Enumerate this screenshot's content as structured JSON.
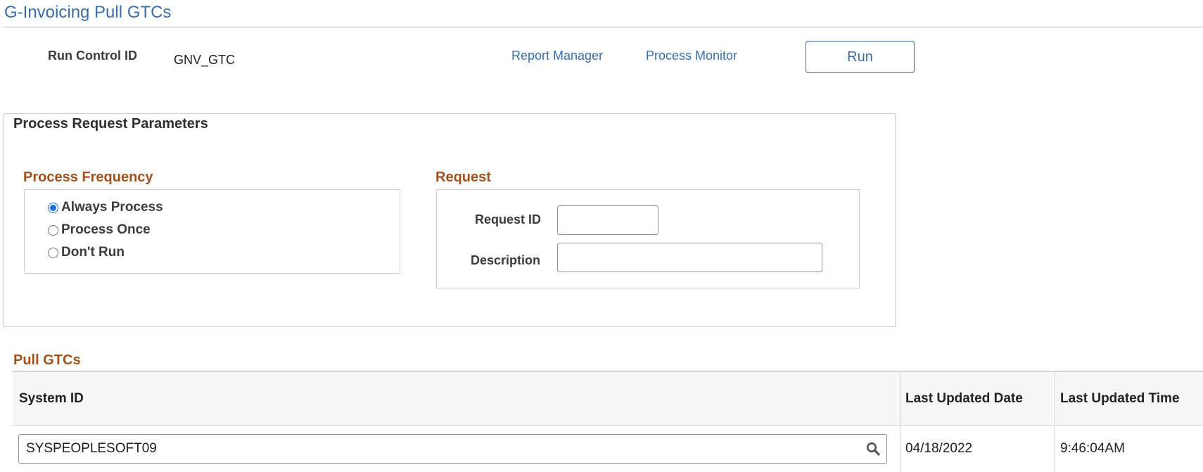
{
  "page": {
    "title": "G-Invoicing Pull GTCs"
  },
  "header": {
    "run_control_label": "Run Control ID",
    "run_control_value": "GNV_GTC",
    "report_manager_link": "Report Manager",
    "process_monitor_link": "Process Monitor",
    "run_button": "Run"
  },
  "params": {
    "title": "Process Request Parameters",
    "frequency": {
      "title": "Process Frequency",
      "options": [
        {
          "label": "Always Process",
          "selected": true
        },
        {
          "label": "Process Once",
          "selected": false
        },
        {
          "label": "Don't Run",
          "selected": false
        }
      ]
    },
    "request": {
      "title": "Request",
      "request_id_label": "Request ID",
      "request_id_value": "",
      "description_label": "Description",
      "description_value": ""
    }
  },
  "grid": {
    "title": "Pull GTCs",
    "columns": [
      "System ID",
      "Last Updated Date",
      "Last Updated Time"
    ],
    "rows": [
      {
        "system_id": "SYSPEOPLESOFT09",
        "date": "04/18/2022",
        "time": "9:46:04AM"
      }
    ]
  },
  "icons": {
    "lookup": "search-icon"
  },
  "colors": {
    "link": "#3a6ea8",
    "section_heading": "#a0521e",
    "radio_accent": "#1f6fd1"
  }
}
